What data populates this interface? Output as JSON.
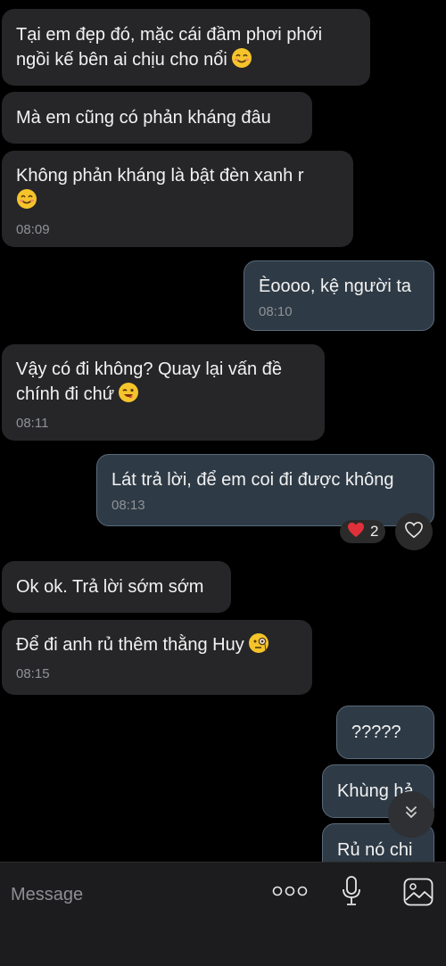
{
  "messages": [
    {
      "text": "Tại em đẹp đó, mặc cái đầm phơi phới\nngồi kế bên ai chịu cho nổi",
      "time": "",
      "emoji": "smiling-face-emoji"
    },
    {
      "text": "Mà em cũng có phản kháng đâu",
      "time": "",
      "emoji": ""
    },
    {
      "text": "Không phản kháng là bật đèn xanh r",
      "time": "08:09",
      "emoji": "smiling-face-emoji"
    },
    {
      "text": "Èoooo, kệ người ta",
      "time": "08:10",
      "emoji": ""
    },
    {
      "text": "Vậy có đi không? Quay lại vấn đề\nchính đi chứ",
      "time": "08:11",
      "emoji": "winking-face-emoji"
    },
    {
      "text": "Lát trả lời, để em coi đi được không",
      "time": "08:13",
      "emoji": ""
    },
    {
      "text": "Ok ok. Trả lời sớm sớm",
      "time": "",
      "emoji": ""
    },
    {
      "text": "Để đi anh rủ thêm thằng Huy",
      "time": "08:15",
      "emoji": "face-with-monocle-emoji"
    },
    {
      "text": "?????",
      "time": "",
      "emoji": ""
    },
    {
      "text": "Khùng hả",
      "time": "",
      "emoji": ""
    },
    {
      "text": "Rủ nó chi",
      "time": "",
      "emoji": ""
    }
  ],
  "reaction": {
    "emoji": "heart-emoji",
    "count": "2"
  },
  "composer": {
    "placeholder": "Message"
  },
  "icons": {
    "like": "heart-outline-icon",
    "scroll": "chevron-double-down-icon",
    "more": "more-dots-icon",
    "mic": "microphone-icon",
    "gallery": "image-icon"
  },
  "colors": {
    "background": "#000000",
    "received_bubble": "#262628",
    "sent_bubble": "#2e3a45",
    "sent_border": "#5a6a79",
    "reaction_heart": "#e0303a"
  }
}
